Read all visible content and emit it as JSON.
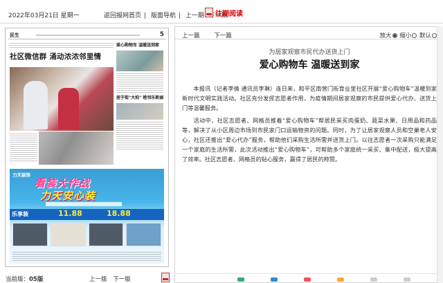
{
  "topbar": {
    "date": "2022年03月21日 星期一",
    "nav": [
      "返回报网首页",
      "版面导航",
      "上一期",
      "下一期"
    ],
    "past_reading": "往期阅读"
  },
  "paper": {
    "section": "民生",
    "page_no": "5",
    "headline": "社区微信群 涌动浓浓邻里情",
    "right_headline": "爱心购物车 温暖送到家",
    "right_headline2": "居于街\"大拍\" 睦邻乐新娱",
    "ad": {
      "brand": "力天装饰",
      "slogan1": "看装大作战",
      "slogan2": "力天安心装",
      "package_name": "乐享装",
      "price1": "11.88",
      "price2": "18.88"
    }
  },
  "page_footer": {
    "current_label": "当前版：",
    "current_value": "05版",
    "prev": "上一版",
    "next": "下一版"
  },
  "article": {
    "nav_prev": "上一篇",
    "nav_next": "下一篇",
    "zoom": [
      "放大",
      "缩小",
      "默认"
    ],
    "lead_title": "为居家观察市民代办送货上门",
    "title": "爱心购物车 温暖送到家",
    "paragraphs": [
      "本报讯（记者李倩 通讯员李琳）连日来，和平区南营门街育业里社区开展“爱心购物车”温暖到家新时代文明实践活动。社区充分发挥志愿者作用，为疫情期间居家观察的市民提供爱心代办、送货上门等温馨服务。",
      "活动中，社区志愿者、网格员推着“爱心购物车”帮居民采买肉蛋奶、蔬菜水果、日用品和药品等，解决了从小区周边市场到市民家门口运输物资的问题。同时，为了让居家观察人员和空巢老人安心，社区还推出“爱心代办”服务，帮助他们采购生活所需并送货上门。以往志愿者一次采购只能满足一个家庭的生活所需，此次活动推出“爱心购物车”，可帮助多个家庭统一采买、集中配送，极大提高了效率。社区志愿者、网格员的贴心服务，赢得了居民的称赞。"
    ]
  }
}
